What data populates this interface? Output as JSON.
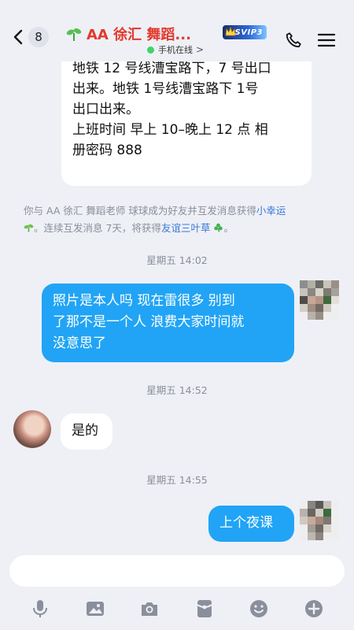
{
  "header": {
    "back_count": "8",
    "title": "AA  徐汇  舞蹈...",
    "vip_label": "SVIP3",
    "status": "手机在线"
  },
  "messages": {
    "top_bubble_lines": [
      "地铁 12 号线漕宝路下，7 号出口",
      "出来。地铁 1号线漕宝路下 1号",
      "出口出来。",
      "上班时间 早上 10–晚上 12 点 相",
      "册密码 888"
    ],
    "system": {
      "prefix": "你与 AA  徐汇  舞蹈老师 球球成为好友并互发消息获得",
      "link1": "小幸运",
      "middle": "。连续互发消息 7天，将获得",
      "link2": "友谊三叶草",
      "suffix": "。"
    },
    "time1": "星期五 14:02",
    "out1_lines": [
      "照片是本人吗 现在雷很多 别到",
      "了那不是一个人 浪费大家时间就",
      "没意思了"
    ],
    "time2": "星期五 14:52",
    "in1": "是的",
    "time3": "星期五 14:55",
    "out2": "上个夜课"
  },
  "input": {
    "placeholder": ""
  },
  "toolbar": {
    "icons": [
      "mic-icon",
      "image-icon",
      "camera-icon",
      "red-packet-icon",
      "emoji-icon",
      "plus-icon"
    ]
  },
  "colors": {
    "accent_blue": "#21a4f5",
    "title_red": "#e2392c",
    "online_green": "#3fd46b"
  }
}
